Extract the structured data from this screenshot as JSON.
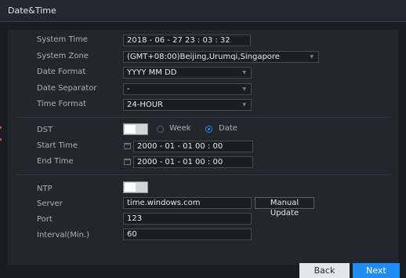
{
  "window": {
    "title": "Date&Time"
  },
  "labels": {
    "system_time": "System Time",
    "system_zone": "System Zone",
    "date_format": "Date Format",
    "date_separator": "Date Separator",
    "time_format": "Time Format",
    "dst": "DST",
    "start_time": "Start Time",
    "end_time": "End Time",
    "ntp": "NTP",
    "server": "Server",
    "port": "Port",
    "interval": "Interval(Min.)"
  },
  "values": {
    "system_time": "2018  - 06 - 27     23 : 03 : 32",
    "system_zone": "(GMT+08:00)Beijing,Urumqi,Singapore",
    "date_format": "YYYY MM DD",
    "date_separator": "-",
    "time_format": "24-HOUR",
    "dst_enabled": false,
    "dst_mode_week": "Week",
    "dst_mode_date": "Date",
    "dst_mode_selected": "Date",
    "start_time": "2000 - 01 - 01    00 : 00",
    "end_time": "2000 - 01 - 01    00 : 00",
    "ntp_enabled": false,
    "server": "time.windows.com",
    "port": "123",
    "interval": "60"
  },
  "buttons": {
    "manual_update": "Manual Update",
    "back": "Back",
    "next": "Next"
  },
  "icons": {
    "dropdown": "chevron-down-icon",
    "calendar": "calendar-icon"
  },
  "colors": {
    "accent": "#1e8cf0",
    "background": "#1b1d23",
    "panel": "#23262d"
  }
}
